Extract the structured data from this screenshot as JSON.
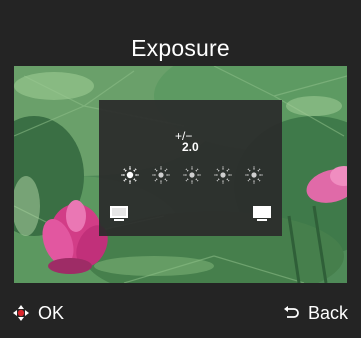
{
  "screen": {
    "title": "Exposure"
  },
  "exposure": {
    "sign_symbol": "+/−",
    "current_value": "2.0",
    "level_count": 5,
    "selected_index": 0,
    "min_icon": "monitor-dark-icon",
    "max_icon": "monitor-bright-icon"
  },
  "footer": {
    "ok_label": "OK",
    "ok_icon": "dpad-icon",
    "back_label": "Back",
    "back_icon": "return-arrow-icon"
  },
  "colors": {
    "background": "#242424",
    "panel": "#2b2b2b",
    "dpad_accent": "#d8262c",
    "text": "#ffffff"
  }
}
